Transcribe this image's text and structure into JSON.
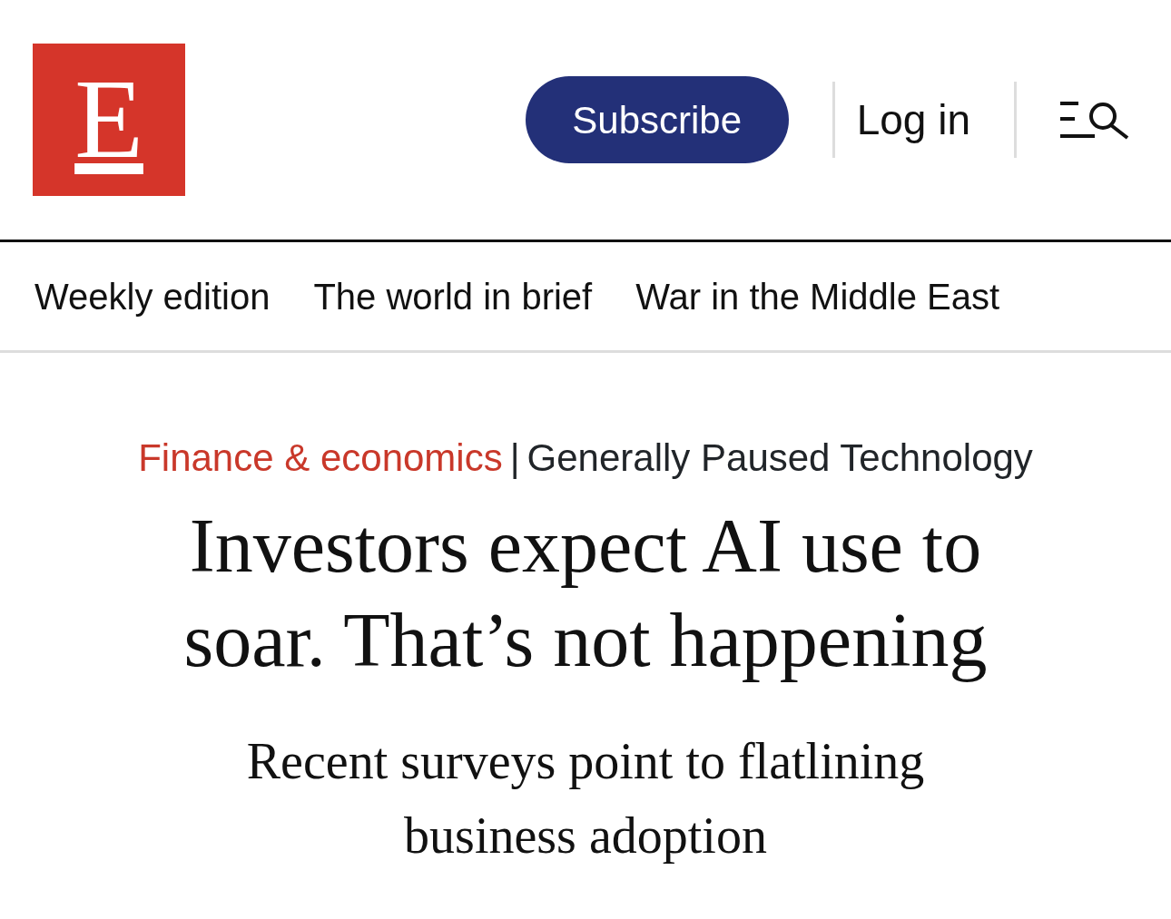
{
  "header": {
    "logo": "E",
    "subscribe": "Subscribe",
    "login": "Log in"
  },
  "nav": [
    {
      "label": "Weekly edition"
    },
    {
      "label": "The world in brief"
    },
    {
      "label": "War in the Middle East"
    }
  ],
  "article": {
    "section": "Finance & economics",
    "separator": "|",
    "column": "Generally Paused Technology",
    "headline": "Investors expect AI use to soar. That’s not happening",
    "subheadline": "Recent surveys point to flatlining business adoption"
  }
}
